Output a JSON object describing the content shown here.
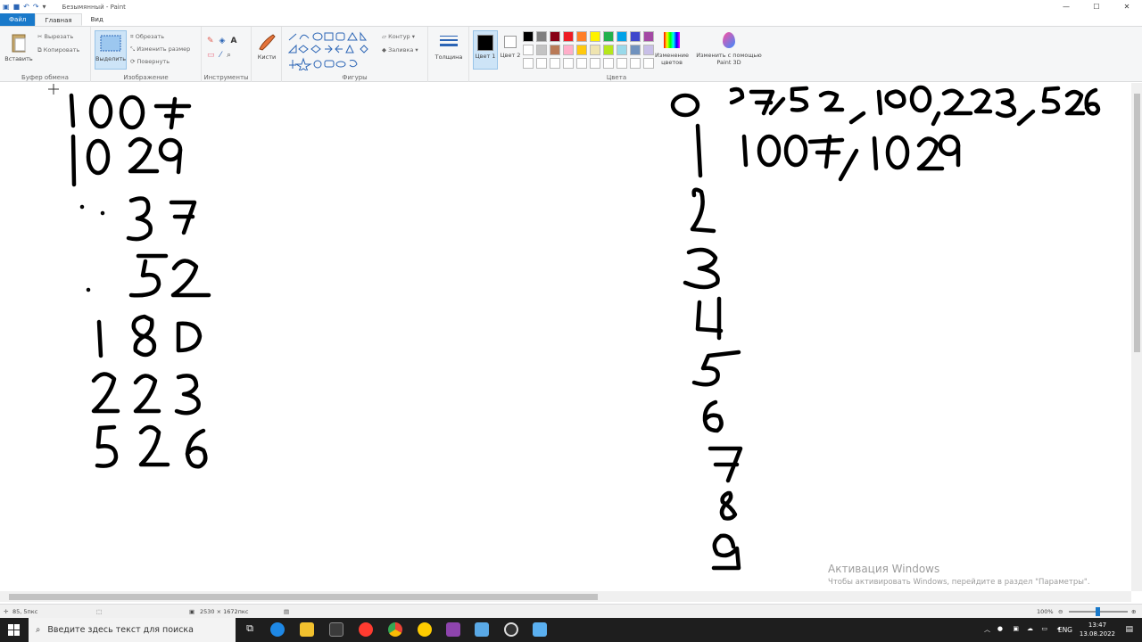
{
  "window": {
    "title": "Безымянный - Paint"
  },
  "tabs": [
    {
      "label": "Файл",
      "kind": "file"
    },
    {
      "label": "Главная",
      "kind": "active"
    },
    {
      "label": "Вид",
      "kind": "normal"
    }
  ],
  "ribbon": {
    "clipboard": {
      "label": "Буфер обмена",
      "paste": "Вставить",
      "cut": "Вырезать",
      "copy": "Копировать"
    },
    "image": {
      "label": "Изображение",
      "select": "Выделить",
      "crop": "Обрезать",
      "resize": "Изменить размер",
      "rotate": "Повернуть"
    },
    "tools": {
      "label": "Инструменты"
    },
    "brushes": {
      "label": "Кисти"
    },
    "shapes": {
      "label": "Фигуры",
      "outline": "Контур",
      "fill": "Заливка"
    },
    "size": {
      "label": "Толщина"
    },
    "colors": {
      "label": "Цвета",
      "color1": "Цвет 1",
      "color2": "Цвет 2",
      "edit": "Изменение цветов",
      "paint3d": "Изменить с помощью Paint 3D",
      "palette": [
        "#000000",
        "#7f7f7f",
        "#880015",
        "#ed1c24",
        "#ff7f27",
        "#fff200",
        "#22b14c",
        "#00a2e8",
        "#3f48cc",
        "#a349a4",
        "#ffffff",
        "#c3c3c3",
        "#b97a57",
        "#ffaec9",
        "#ffc90e",
        "#efe4b0",
        "#b5e61d",
        "#99d9ea",
        "#7092be",
        "#c8bfe7",
        "#ffffff",
        "#ffffff",
        "#ffffff",
        "#ffffff",
        "#ffffff",
        "#ffffff",
        "#ffffff",
        "#ffffff",
        "#ffffff",
        "#ffffff"
      ]
    }
  },
  "watermark": {
    "title": "Активация Windows",
    "subtitle": "Чтобы активировать Windows, перейдите в раздел \"Параметры\"."
  },
  "statusbar": {
    "cursor": "85, 5пкс",
    "size": "2530 × 1672пкс",
    "zoom": "100%"
  },
  "taskbar": {
    "search_placeholder": "Введите здесь текст для поиска",
    "lang": "ENG",
    "time": "13:47",
    "date": "13.08.2022"
  }
}
